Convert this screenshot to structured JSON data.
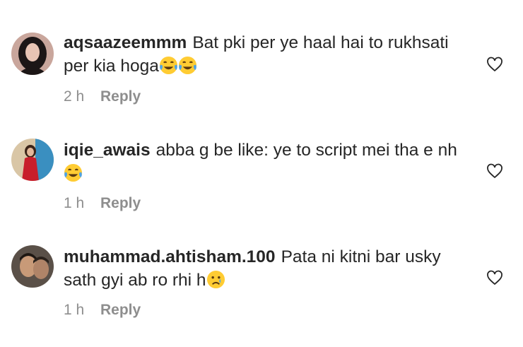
{
  "comments": [
    {
      "username": "aqsaazeemmm",
      "text": "Bat pki per ye haal hai to rukhsati per kia hoga",
      "emojis": [
        "face-with-tears-of-joy",
        "face-with-tears-of-joy"
      ],
      "time": "2 h",
      "reply_label": "Reply"
    },
    {
      "username": "iqie_awais",
      "text": "abba g be like: ye to script mei tha e nh",
      "emojis": [
        "face-with-tears-of-joy"
      ],
      "time": "1 h",
      "reply_label": "Reply"
    },
    {
      "username": "muhammad.ahtisham.100",
      "text": "Pata ni kitni bar usky sath gyi ab ro rhi h",
      "emojis": [
        "crying-face"
      ],
      "time": "1 h",
      "reply_label": "Reply"
    }
  ],
  "icons": {
    "like": "heart-outline-icon"
  },
  "colors": {
    "text": "#262626",
    "secondary": "#8e8e8e"
  }
}
